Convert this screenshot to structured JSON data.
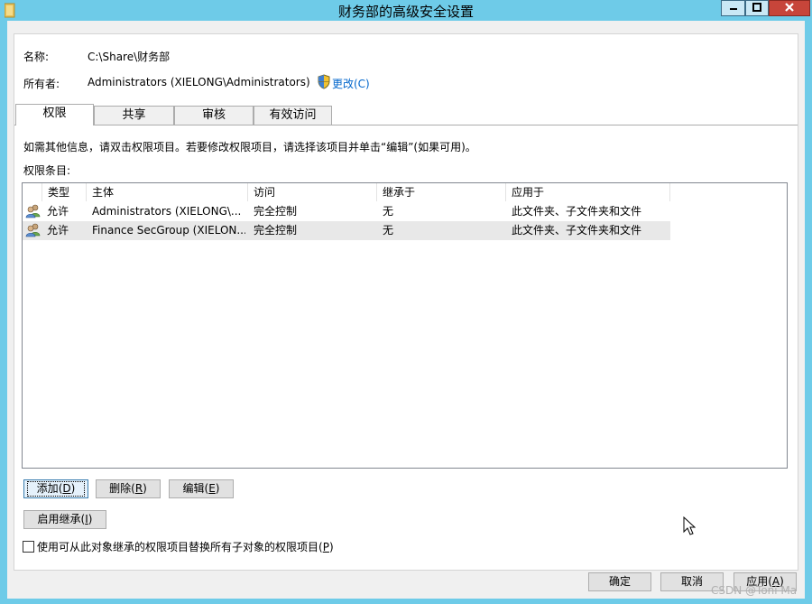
{
  "window": {
    "title": "财务部的高级安全设置",
    "folder_icon": "folder-icon",
    "min_icon": "minimize-icon",
    "max_icon": "maximize-icon",
    "close_icon": "close-icon"
  },
  "info": {
    "name_label": "名称:",
    "name_value": "C:\\Share\\财务部",
    "owner_label": "所有者:",
    "owner_value": "Administrators (XIELONG\\Administrators)",
    "change_link": "更改(C)"
  },
  "tabs": [
    {
      "label": "权限",
      "active": true
    },
    {
      "label": "共享",
      "active": false
    },
    {
      "label": "审核",
      "active": false
    },
    {
      "label": "有效访问",
      "active": false
    }
  ],
  "permissions": {
    "info_text": "如需其他信息，请双击权限项目。若要修改权限项目，请选择该项目并单击“编辑”(如果可用)。",
    "entries_label": "权限条目:",
    "columns": [
      "类型",
      "主体",
      "访问",
      "继承于",
      "应用于"
    ],
    "rows": [
      {
        "type": "允许",
        "principal": "Administrators (XIELONG\\...",
        "access": "完全控制",
        "inherited": "无",
        "applies": "此文件夹、子文件夹和文件"
      },
      {
        "type": "允许",
        "principal": "Finance SecGroup (XIELON...",
        "access": "完全控制",
        "inherited": "无",
        "applies": "此文件夹、子文件夹和文件"
      }
    ]
  },
  "buttons": {
    "add_text": "添加",
    "add_key": "D",
    "remove_text": "删除",
    "remove_key": "R",
    "edit_text": "编辑",
    "edit_key": "E",
    "inherit_text": "启用继承",
    "inherit_key": "I",
    "ok": "确定",
    "cancel": "取消",
    "apply_text": "应用",
    "apply_key": "A"
  },
  "replace_checkbox": {
    "text": "使用可从此对象继承的权限项目替换所有子对象的权限项目",
    "key": "P",
    "checked": false
  },
  "watermark": "CSDN @Toni Ma"
}
